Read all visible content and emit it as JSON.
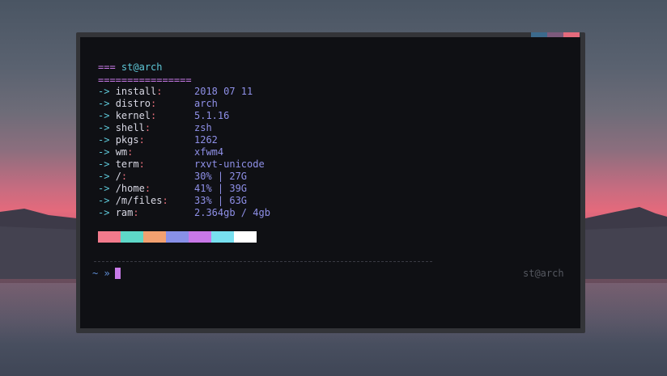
{
  "wallpaper": {
    "description_colors": [
      "#4a5563",
      "#e46a7c",
      "#3f4656"
    ]
  },
  "terminal": {
    "tab_colors": [
      "#3c6a8c",
      "#7c5a7c",
      "#e46a7c"
    ],
    "header": {
      "prefix": "===",
      "host": "st@arch",
      "underline": "================"
    },
    "info": [
      {
        "key": "install",
        "value": "2018 07 11"
      },
      {
        "key": "distro",
        "value": "arch"
      },
      {
        "key": "kernel",
        "value": "5.1.16"
      },
      {
        "key": "shell",
        "value": "zsh"
      },
      {
        "key": "pkgs",
        "value": "1262"
      },
      {
        "key": "wm",
        "value": "xfwm4"
      },
      {
        "key": "term",
        "value": "rxvt-unicode"
      },
      {
        "key": "/",
        "value": "30% | 27G"
      },
      {
        "key": "/home",
        "value": "41% | 39G"
      },
      {
        "key": "/m/files",
        "value": "33% | 63G"
      },
      {
        "key": "ram",
        "value": "2.364gb / 4gb"
      }
    ],
    "arrow": "->",
    "colon": ":",
    "swatches": [
      "#f27a8c",
      "#5ed8c8",
      "#f2a070",
      "#8890e8",
      "#c878e8",
      "#78e0f0",
      "#ffffff"
    ],
    "prompt": {
      "text": "~ »",
      "right_host": "st@arch"
    },
    "accent_colors": {
      "cyan": "#5ec8d8",
      "purple": "#c87ae8",
      "pink": "#e8707c",
      "value": "#8f90e8"
    }
  }
}
